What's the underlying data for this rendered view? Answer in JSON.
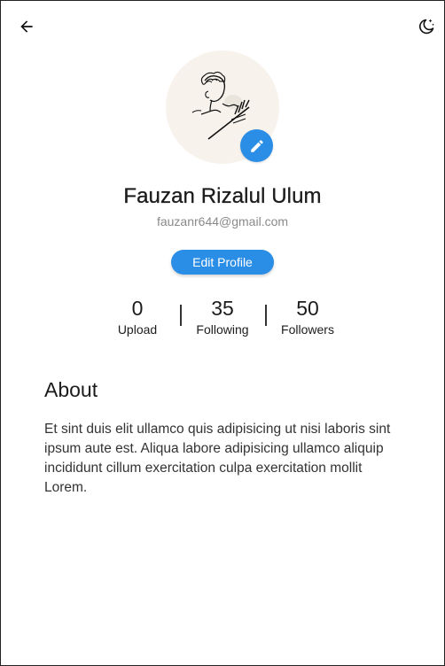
{
  "header": {
    "back_icon": "arrow-left-icon",
    "theme_icon": "moon-stars-icon"
  },
  "profile": {
    "avatar_icon": "user-illustration",
    "edit_avatar_icon": "pencil-icon",
    "name": "Fauzan Rizalul Ulum",
    "email": "fauzanr644@gmail.com",
    "edit_profile_label": "Edit Profile"
  },
  "stats": [
    {
      "value": "0",
      "label": "Upload"
    },
    {
      "value": "35",
      "label": "Following"
    },
    {
      "value": "50",
      "label": "Followers"
    }
  ],
  "about": {
    "title": "About",
    "text": "Et sint duis elit ullamco quis adipisicing ut nisi laboris sint ipsum aute est. Aliqua labore adipisicing ullamco aliquip incididunt cillum exercitation culpa exercitation mollit Lorem."
  },
  "colors": {
    "accent": "#2b8ee6",
    "avatar_bg": "#f7f3ec",
    "muted_text": "#8a8a8a"
  }
}
